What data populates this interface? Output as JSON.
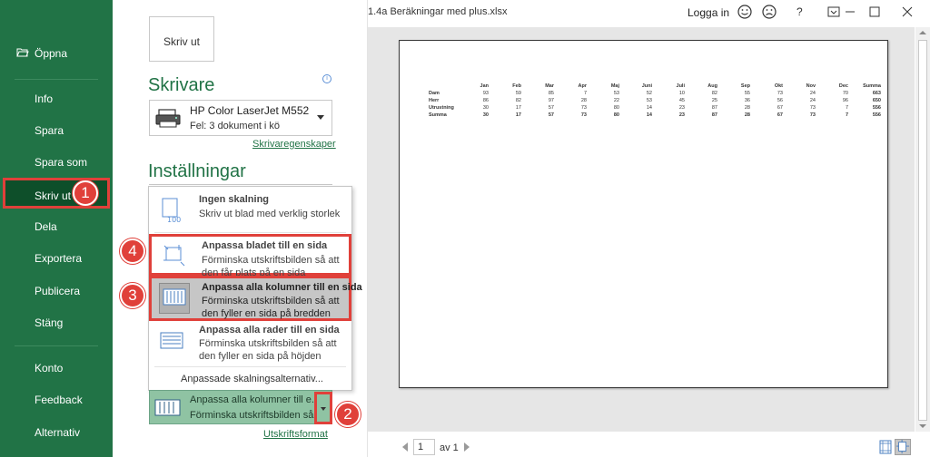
{
  "window": {
    "title": "1.4a  Beräkningar med plus.xlsx",
    "login_label": "Logga in",
    "help_label": "?"
  },
  "sidebar": {
    "open_label": "Öppna",
    "items": [
      {
        "label": "Info"
      },
      {
        "label": "Spara"
      },
      {
        "label": "Spara som"
      },
      {
        "label": "Skriv ut"
      },
      {
        "label": "Dela"
      },
      {
        "label": "Exportera"
      },
      {
        "label": "Publicera"
      },
      {
        "label": "Stäng"
      },
      {
        "label": "Konto"
      },
      {
        "label": "Feedback"
      },
      {
        "label": "Alternativ"
      }
    ]
  },
  "print": {
    "print_button": "Skriv ut",
    "printer_heading": "Skrivare",
    "printer_name": "HP Color LaserJet M552 [BC...",
    "printer_status": "Fel: 3 dokument i kö",
    "printer_properties": "Skrivaregenskaper",
    "settings_heading": "Inställningar",
    "page_setup_link": "Utskriftsformat"
  },
  "scaling": {
    "options": [
      {
        "title": "Ingen skalning",
        "desc": "Skriv ut blad med verklig storlek"
      },
      {
        "title": "Anpassa bladet till en sida",
        "desc": "Förminska utskriftsbilden så att den får plats på en sida"
      },
      {
        "title": "Anpassa alla kolumner till en sida",
        "desc": "Förminska utskriftsbilden så att den fyller en sida på bredden"
      },
      {
        "title": "Anpassa alla rader till en sida",
        "desc": "Förminska utskriftsbilden så att den fyller en sida på höjden"
      }
    ],
    "custom_label": "Anpassade skalningsalternativ...",
    "current_title": "Anpassa alla kolumner till e...",
    "current_desc": "Förminska utskriftsbilden så...",
    "icon_100": "100"
  },
  "callouts": [
    "1",
    "2",
    "3",
    "4"
  ],
  "preview": {
    "headers": [
      "Jan",
      "Feb",
      "Mar",
      "Apr",
      "Maj",
      "Juni",
      "Juli",
      "Aug",
      "Sep",
      "Okt",
      "Nov",
      "Dec",
      "Summa"
    ],
    "rows": [
      {
        "label": "Dam",
        "values": [
          "93",
          "59",
          "85",
          "7",
          "53",
          "52",
          "10",
          "82",
          "55",
          "73",
          "24",
          "70",
          "663"
        ]
      },
      {
        "label": "Herr",
        "values": [
          "86",
          "82",
          "97",
          "28",
          "22",
          "53",
          "45",
          "25",
          "36",
          "56",
          "24",
          "96",
          "650"
        ]
      },
      {
        "label": "Utrustning",
        "values": [
          "30",
          "17",
          "57",
          "73",
          "80",
          "14",
          "23",
          "87",
          "28",
          "67",
          "73",
          "7",
          "556"
        ]
      },
      {
        "label": "Summa",
        "values": [
          "30",
          "17",
          "57",
          "73",
          "80",
          "14",
          "23",
          "87",
          "28",
          "67",
          "73",
          "7",
          "556"
        ]
      }
    ]
  },
  "pager": {
    "current_page": "1",
    "of_label": "av 1"
  },
  "colors": {
    "accent": "#217346",
    "highlight": "#e0403a"
  }
}
